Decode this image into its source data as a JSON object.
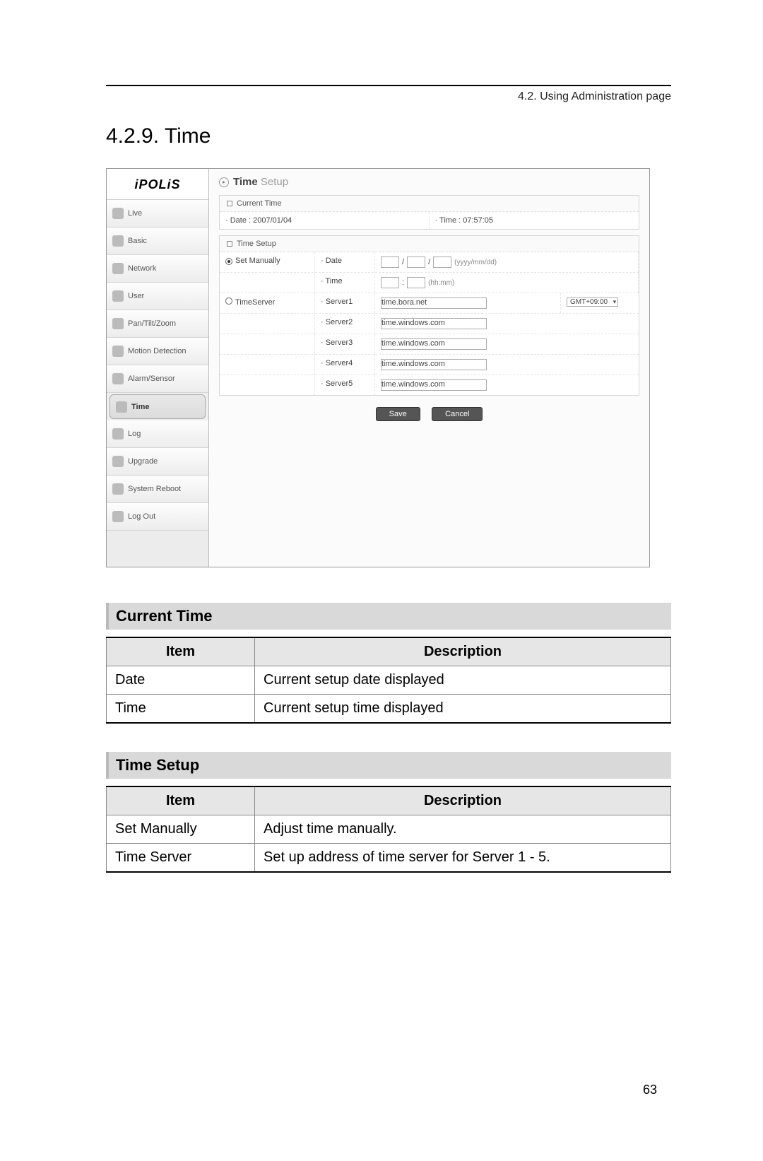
{
  "header": "4.2. Using Administration page",
  "section_title": "4.2.9. Time",
  "page_number": "63",
  "screenshot": {
    "logo": "iPOLiS",
    "nav": [
      {
        "label": "Live"
      },
      {
        "label": "Basic"
      },
      {
        "label": "Network"
      },
      {
        "label": "User"
      },
      {
        "label": "Pan/Tilt/Zoom"
      },
      {
        "label": "Motion Detection"
      },
      {
        "label": "Alarm/Sensor"
      },
      {
        "label": "Time",
        "active": true
      },
      {
        "label": "Log"
      },
      {
        "label": "Upgrade"
      },
      {
        "label": "System Reboot"
      },
      {
        "label": "Log Out"
      }
    ],
    "page_title_strong": "Time",
    "page_title_light": "Setup",
    "current_time": {
      "heading": "Current Time",
      "date_label": "· Date : 2007/01/04",
      "time_label": "· Time : 07:57:05"
    },
    "time_setup": {
      "heading": "Time Setup",
      "set_manually": "Set Manually",
      "timeserver": "TimeServer",
      "date_label": "· Date",
      "date_hint": "(yyyy/mm/dd)",
      "time_label": "· Time",
      "time_hint": "(hh:mm)",
      "servers": [
        {
          "label": "· Server1",
          "value": "time.bora.net",
          "tz": "GMT+09:00"
        },
        {
          "label": "· Server2",
          "value": "time.windows.com"
        },
        {
          "label": "· Server3",
          "value": "time.windows.com"
        },
        {
          "label": "· Server4",
          "value": "time.windows.com"
        },
        {
          "label": "· Server5",
          "value": "time.windows.com"
        }
      ],
      "save": "Save",
      "cancel": "Cancel"
    }
  },
  "tables": {
    "current_time": {
      "title": "Current Time",
      "head_item": "Item",
      "head_desc": "Description",
      "rows": [
        {
          "item": "Date",
          "desc": "Current setup date displayed"
        },
        {
          "item": "Time",
          "desc": "Current setup time displayed"
        }
      ]
    },
    "time_setup": {
      "title": "Time Setup",
      "head_item": "Item",
      "head_desc": "Description",
      "rows": [
        {
          "item": "Set Manually",
          "desc": "Adjust time manually."
        },
        {
          "item": "Time Server",
          "desc": "Set up address of time server for Server 1 - 5."
        }
      ]
    }
  }
}
